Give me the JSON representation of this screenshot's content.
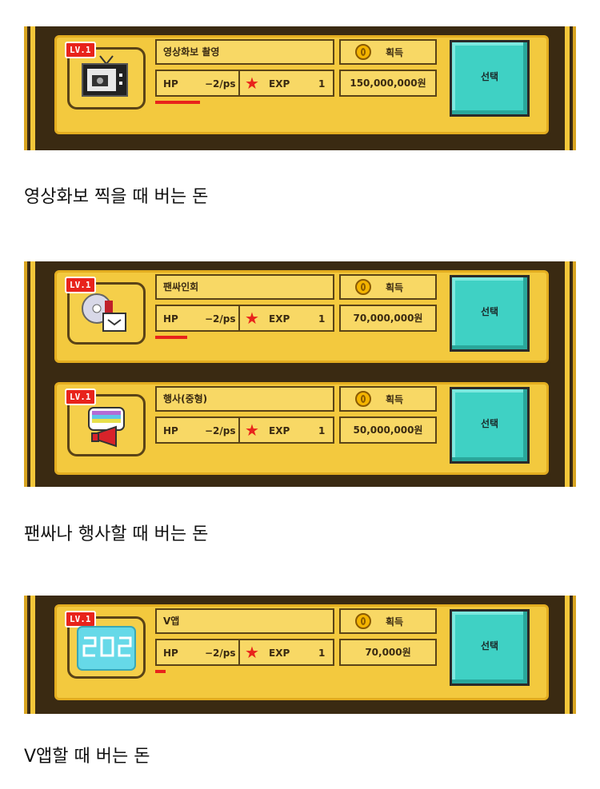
{
  "level_badge": "LV.1",
  "earn_label": "획득",
  "hp_label": "HP",
  "hp_rate": "−2/ps",
  "exp_label": "EXP",
  "exp_value": "1",
  "select_label": "선택",
  "cards": [
    {
      "name": "영상화보 촬영",
      "money": "150,000,000원",
      "hp_fill": 0.25,
      "icon": "tv-camera-icon"
    },
    {
      "name": "팬싸인회",
      "money": "70,000,000원",
      "hp_fill": 0.18,
      "icon": "cd-signing-icon"
    },
    {
      "name": "행사(중형)",
      "money": "50,000,000원",
      "hp_fill": 0,
      "icon": "megaphone-event-icon"
    },
    {
      "name": "V앱",
      "money": "70,000원",
      "hp_fill": 0.06,
      "icon": "vlive-icon"
    }
  ],
  "captions": [
    "영상화보 찍을 때 버는 돈",
    "팬싸나 행사할 때 버는 돈",
    "V앱할 때 버는 돈"
  ],
  "colors": {
    "panel": "#3a2a12",
    "card": "#f3c93e",
    "select": "#3fd1c4",
    "hp": "#e8231b"
  }
}
